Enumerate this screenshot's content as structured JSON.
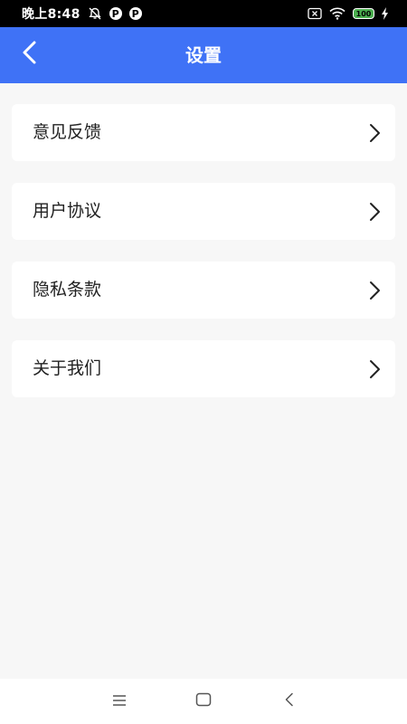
{
  "status_bar": {
    "time": "晚上8:48",
    "battery": "100",
    "icons": [
      "alarm-off-icon",
      "parking-p-icon",
      "parking-p-icon",
      "sim-no-signal-icon",
      "wifi-icon",
      "battery-icon",
      "charging-bolt-icon"
    ]
  },
  "header": {
    "title": "设置",
    "back_icon": "back-arrow-icon",
    "background_color": "#3f72f6"
  },
  "settings": {
    "items": [
      {
        "label": "意见反馈",
        "icon": "chevron-right-icon"
      },
      {
        "label": "用户协议",
        "icon": "chevron-right-icon"
      },
      {
        "label": "隐私条款",
        "icon": "chevron-right-icon"
      },
      {
        "label": "关于我们",
        "icon": "chevron-right-icon"
      }
    ]
  },
  "nav_bar": {
    "buttons": [
      "menu-icon",
      "home-square-icon",
      "back-triangle-icon"
    ]
  }
}
